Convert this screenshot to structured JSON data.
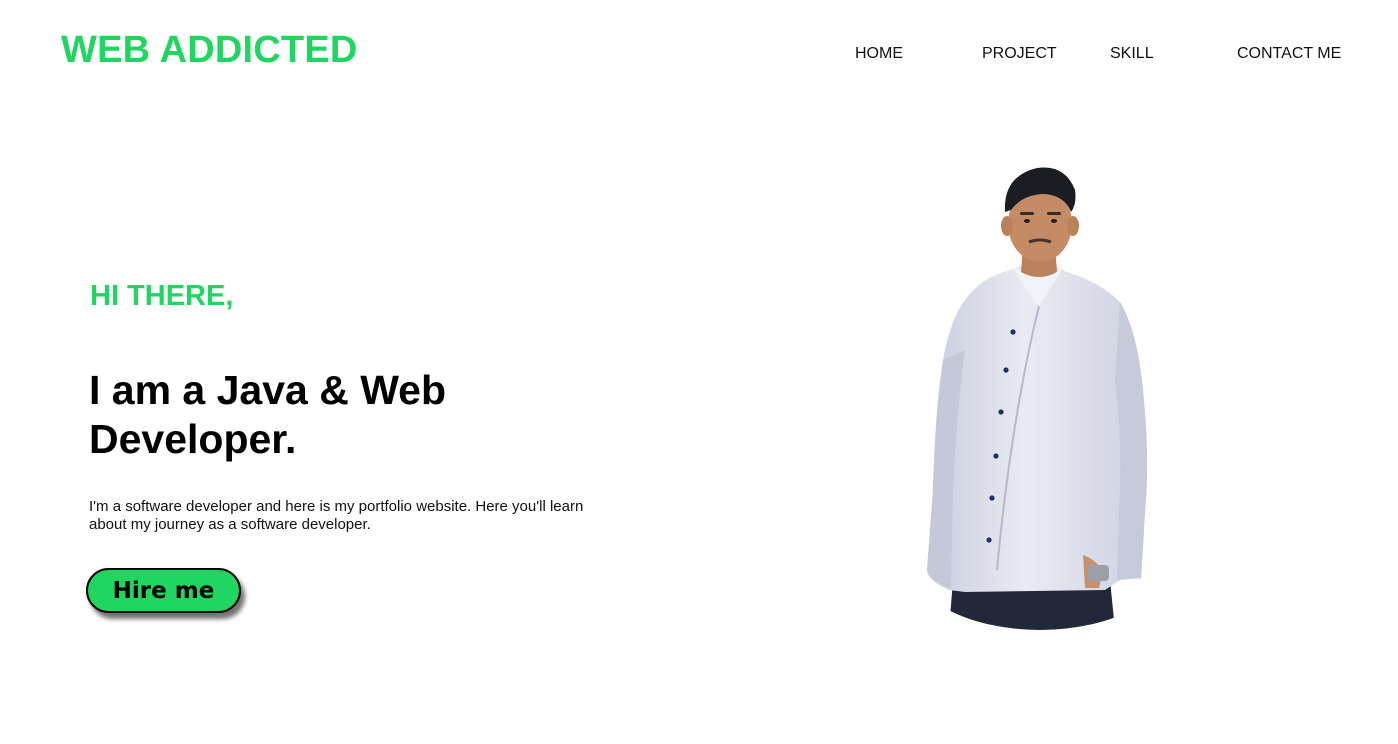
{
  "brand": {
    "logo_text": "WEB ADDICTED",
    "accent_color": "#1fd660"
  },
  "nav": {
    "items": [
      {
        "label": "HOME"
      },
      {
        "label": "PROJECT"
      },
      {
        "label": "SKILL"
      },
      {
        "label": "CONTACT ME"
      }
    ]
  },
  "hero": {
    "greeting": "HI THERE,",
    "headline": "I am a Java & Web Developer.",
    "intro": "I'm a software developer and here is my portfolio website. Here you'll learn about my journey as a software developer.",
    "cta_label": "Hire me",
    "portrait_icon": "person-portrait"
  }
}
